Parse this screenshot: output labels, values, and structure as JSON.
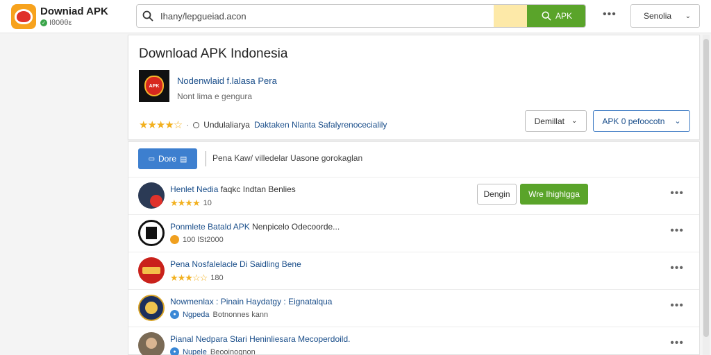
{
  "header": {
    "brand_title": "Downiad APK",
    "brand_sub": "Ιθ0θθε",
    "search_value": "Ihany/lepgueiad.acon",
    "search_button": "ΑΡΚ",
    "select_label": "Senolia"
  },
  "app_card": {
    "title": "Download APK Indonesia",
    "app_name": "Nodenwlaid f.lalasa Pera",
    "app_sub": "Nont lima e gengura",
    "meta_text": "Undulaliarya",
    "meta_link": "Daktaken Nlanta Safalyrenocecialily",
    "detail_button": "Demillat",
    "apk_button": "APK 0 pefoocotn"
  },
  "list": {
    "filter_button": "Dore",
    "filter_text": "Pena Kaw/ villedelar Uasone gorokaglan",
    "rows": [
      {
        "title": "Henlet Nedia",
        "title_rest": "faqkc Indtan Benlies",
        "sub": "10",
        "btn_secondary": "Dengin",
        "btn_primary": "Wre Ihighlgga"
      },
      {
        "title": "Ponmlete Batald APK",
        "title_rest": "Nenpicelo Odecoorde...",
        "sub": "100 lSt2000"
      },
      {
        "title": "Pena Nosfalelacle Di Saidling Bene",
        "title_rest": "",
        "sub": "180"
      },
      {
        "title": "Nowmenlax : Pinain Haydatgy : Eignatalqua",
        "title_rest": "",
        "sub_link": "Ngpeda",
        "sub": "Botnonnes kann"
      },
      {
        "title": "Pianal Nedpara Stari Heninliesara Mecoperdoild.",
        "title_rest": "",
        "sub_link": "Nupele",
        "sub": "Beooinognon"
      }
    ]
  },
  "colors": {
    "accent_green": "#5aa42a",
    "accent_blue": "#3d7fcf",
    "link_blue": "#1a4e8a",
    "star_gold": "#f2b01e"
  }
}
